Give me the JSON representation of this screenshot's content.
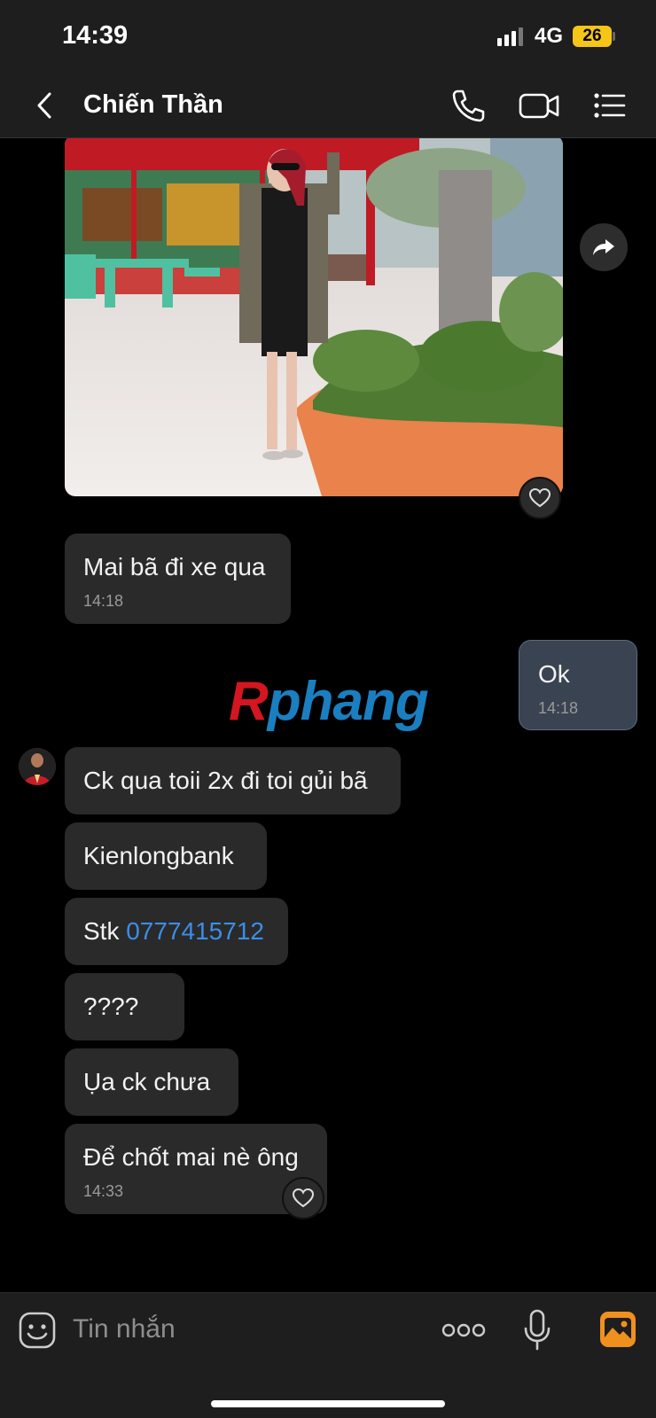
{
  "status_bar": {
    "time": "14:39",
    "network": "4G",
    "battery": "26"
  },
  "header": {
    "title": "Chiến Thần"
  },
  "messages": {
    "m1": {
      "text": "Mai bã đi xe qua",
      "time": "14:18"
    },
    "m2": {
      "text": "Ok",
      "time": "14:18"
    },
    "m3": {
      "text": "Ck qua toii 2x đi toi gủi bã"
    },
    "m4": {
      "text": "Kienlongbank"
    },
    "m5": {
      "prefix": "Stk ",
      "link": "0777415712"
    },
    "m6": {
      "text": "????"
    },
    "m7": {
      "text": "Ụa ck chưa"
    },
    "m8": {
      "text": "Để chốt mai nè ông",
      "time": "14:33"
    }
  },
  "watermark": {
    "part1": "R",
    "part2": "phang"
  },
  "input": {
    "placeholder": "Tin nhắn"
  },
  "colors": {
    "accent": "#3b8ee8",
    "battery": "#f5c518",
    "gallery": "#f0901e",
    "my_bubble": "#3a4352"
  }
}
